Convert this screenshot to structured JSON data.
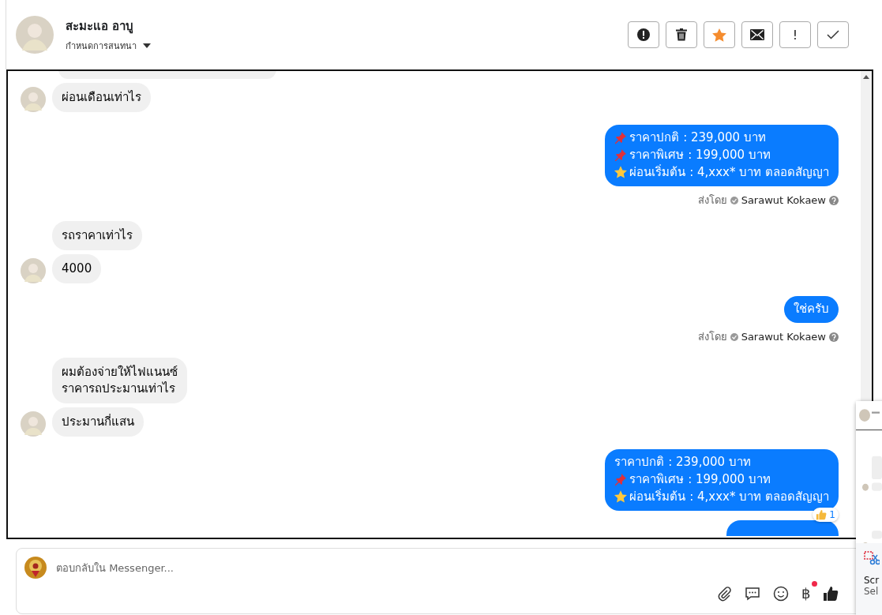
{
  "header": {
    "name": "สะมะแอ อาบู",
    "subtitle": "กำหนดการสนทนา",
    "actions": [
      {
        "kind": "alert"
      },
      {
        "kind": "trash"
      },
      {
        "kind": "star"
      },
      {
        "kind": "mail"
      },
      {
        "kind": "text",
        "label": "!"
      },
      {
        "kind": "check"
      }
    ]
  },
  "messages": [
    {
      "kind": "fragment_in"
    },
    {
      "kind": "incoming",
      "avatar": true,
      "lines": [
        {
          "text": "ผ่อนเดือนเท่าไร"
        }
      ]
    },
    {
      "kind": "outgoing",
      "lines": [
        {
          "kind": "pin",
          "text": "ราคาปกติ : 239,000 บาท"
        },
        {
          "kind": "pin",
          "text": "ราคาพิเศษ : 199,000 บาท"
        },
        {
          "kind": "star",
          "text": "ผ่อนเริ่มต้น : 4,xxx* บาท ตลอดสัญญา"
        }
      ],
      "sent_by": {
        "prefix": "ส่งโดย",
        "name": "Sarawut Kokaew"
      }
    },
    {
      "kind": "incoming",
      "avatar": false,
      "lines": [
        {
          "text": "รถราคาเท่าไร"
        }
      ]
    },
    {
      "kind": "incoming",
      "avatar": true,
      "lines": [
        {
          "text": "4000"
        }
      ]
    },
    {
      "kind": "outgoing",
      "lines": [
        {
          "text": "ใช่ครับ"
        }
      ],
      "sent_by": {
        "prefix": "ส่งโดย",
        "name": "Sarawut Kokaew"
      }
    },
    {
      "kind": "incoming",
      "avatar": false,
      "lines": [
        {
          "text": "ผมต้องจ่ายให้ไฟแนนซ์"
        },
        {
          "text": "ราคารถประมานเท่าไร"
        }
      ]
    },
    {
      "kind": "incoming",
      "avatar": true,
      "lines": [
        {
          "text": "ประมานกี่แสน"
        }
      ]
    },
    {
      "kind": "outgoing",
      "lines": [
        {
          "kind": "plain",
          "text": "ราคาปกติ : 239,000 บาท"
        },
        {
          "kind": "pin",
          "text": "ราคาพิเศษ : 199,000 บาท"
        },
        {
          "kind": "star",
          "text": "ผ่อนเริ่มต้น : 4,xxx* บาท ตลอดสัญญา"
        }
      ],
      "reaction": {
        "count": "1"
      }
    },
    {
      "kind": "fragment_out"
    }
  ],
  "composer": {
    "placeholder": "ตอบกลับใน Messenger...",
    "currency": "฿"
  },
  "side_popup": {
    "title": "Scr",
    "subtitle": "Sel"
  }
}
